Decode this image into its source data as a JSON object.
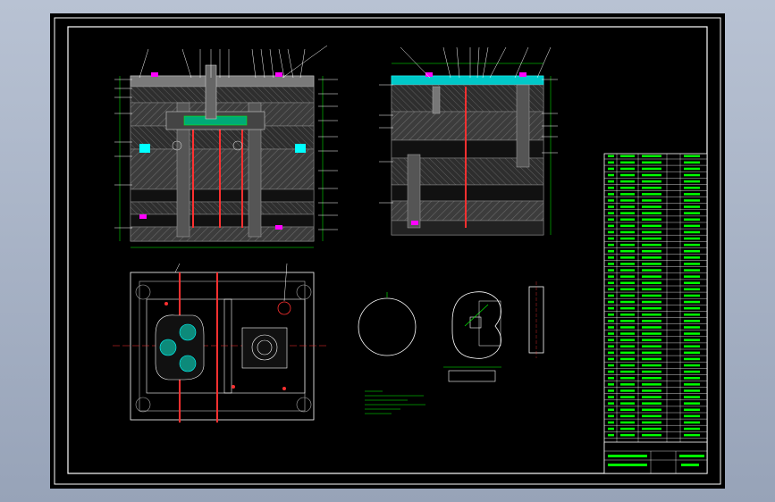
{
  "app": {
    "title": ""
  },
  "drawing": {
    "colors": {
      "frame": "#ffffff",
      "steel": "#7a7a7a",
      "hatch": "#5a5a5a",
      "green": "#00ff00",
      "magenta": "#ff00ff",
      "red": "#ff3030",
      "cyan": "#00ffff",
      "yellow": "#ffff00"
    },
    "icons": [
      "outline-circle-icon",
      "part-profile-icon",
      "side-view-icon"
    ]
  }
}
